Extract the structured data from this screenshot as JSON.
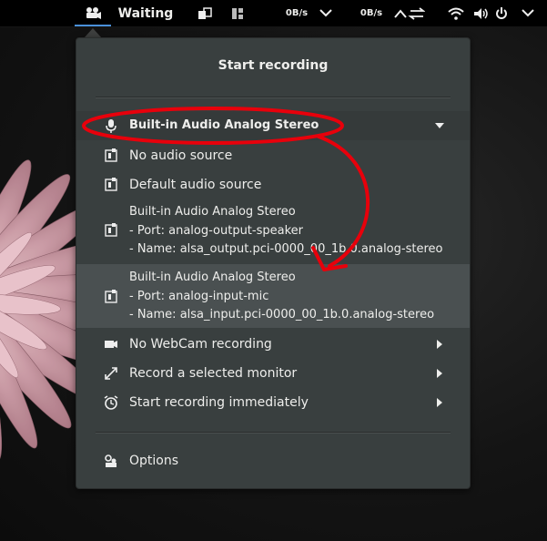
{
  "topbar": {
    "status": "Waiting",
    "down_speed": "0B/s",
    "up_speed": "0B/s"
  },
  "menu": {
    "title": "Start recording",
    "audio_selected": "Built-in Audio Analog Stereo",
    "sources": [
      {
        "label": "No audio source"
      },
      {
        "label": "Default audio source"
      },
      {
        "label": "Built-in Audio Analog Stereo",
        "port": "- Port: analog-output-speaker",
        "name": "- Name: alsa_output.pci-0000_00_1b.0.analog-stereo"
      },
      {
        "label": "Built-in Audio Analog Stereo",
        "port": "- Port: analog-input-mic",
        "name": "- Name: alsa_input.pci-0000_00_1b.0.analog-stereo"
      }
    ],
    "options": [
      {
        "label": "No WebCam recording",
        "icon": "camera-icon"
      },
      {
        "label": "Record a selected monitor",
        "icon": "fullscreen-icon"
      },
      {
        "label": "Start recording immediately",
        "icon": "alarm-clock-icon"
      }
    ],
    "settings_label": "Options"
  },
  "colors": {
    "menu_bg": "#393f3f",
    "highlight": "#4a5051",
    "annotation": "#e8000b",
    "active_underline": "#4a90d9"
  }
}
